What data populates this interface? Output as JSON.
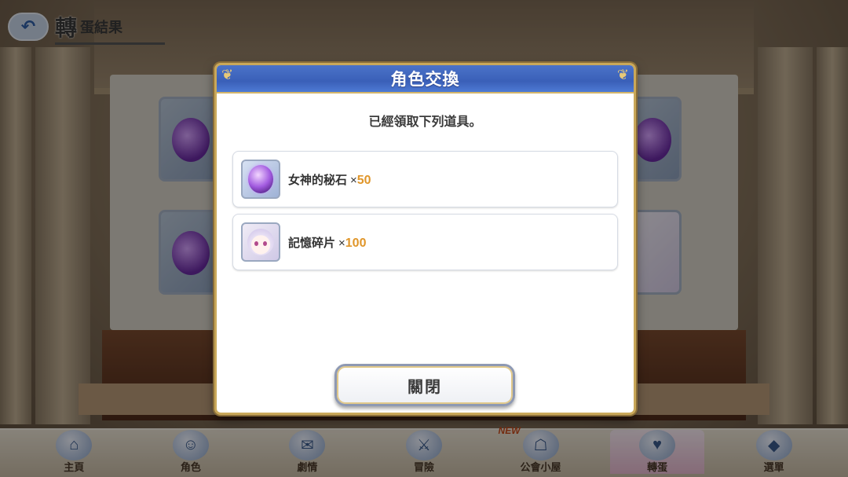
{
  "header": {
    "back_icon": "back-arrow-icon",
    "title_big": "轉",
    "title_small": "蛋結果"
  },
  "dialog": {
    "title": "角色交換",
    "message": "已經領取下列道具。",
    "items": [
      {
        "name": "女神的秘石",
        "x": "×",
        "qty": "50",
        "icon": "goddess-stone-icon"
      },
      {
        "name": "記憶碎片",
        "x": "×",
        "qty": "100",
        "icon": "memory-shard-icon"
      }
    ],
    "close_label": "關閉"
  },
  "bottom_nav": {
    "items": [
      {
        "label": "主頁",
        "icon": "home-icon"
      },
      {
        "label": "角色",
        "icon": "character-icon"
      },
      {
        "label": "劇情",
        "icon": "story-scroll-icon"
      },
      {
        "label": "冒險",
        "icon": "adventure-sword-icon"
      },
      {
        "label": "公會小屋",
        "icon": "guild-house-icon",
        "badge": "NEW"
      },
      {
        "label": "轉蛋",
        "icon": "gacha-icon",
        "active": true
      },
      {
        "label": "選單",
        "icon": "menu-crystal-icon"
      }
    ]
  },
  "colors": {
    "header_blue": "#3a5fb8",
    "quantity_orange": "#e0962a",
    "border_gold": "#c9a85a"
  }
}
